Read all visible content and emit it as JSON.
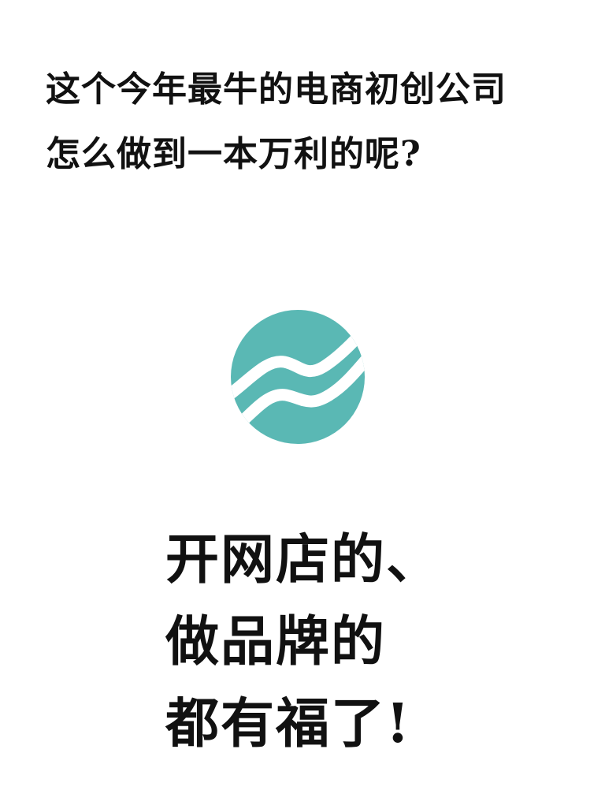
{
  "headline": {
    "line1": "这个今年最牛的电商初创公司",
    "line2": "怎么做到一本万利的呢?"
  },
  "logo": {
    "icon": "teal-circle-wave-logo",
    "color": "#5ab8b4"
  },
  "slogan": {
    "line1": "开网店的、",
    "line2": "做品牌的",
    "line3": "都有福了!"
  }
}
